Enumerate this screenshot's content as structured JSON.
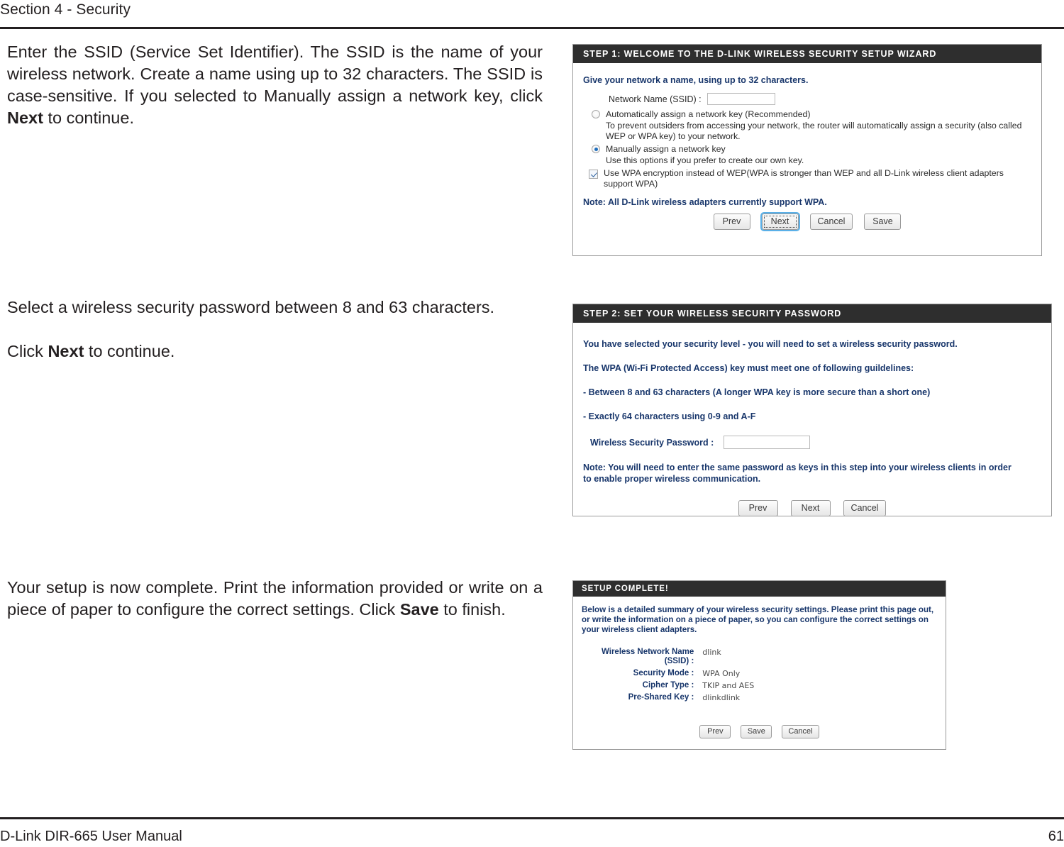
{
  "header": {
    "section_title": "Section 4 - Security"
  },
  "footer": {
    "manual_name": "D-Link DIR-665 User Manual",
    "page_number": "61"
  },
  "body_copy": [
    {
      "id": "copy-step1",
      "parts": [
        {
          "text": "Enter the SSID (Service Set Identifier). The SSID is the name of your wireless network. Create a name using up to 32 characters. The SSID is case-sensitive. If you selected to Manually assign a network key, click ",
          "bold": false
        },
        {
          "text": "Next",
          "bold": true
        },
        {
          "text": " to continue.",
          "bold": false
        }
      ]
    },
    {
      "id": "copy-step2",
      "line1": "Select a wireless security password between 8 and 63 characters.",
      "parts": [
        {
          "text": "Click ",
          "bold": false
        },
        {
          "text": "Next",
          "bold": true
        },
        {
          "text": " to continue.",
          "bold": false
        }
      ]
    },
    {
      "id": "copy-complete",
      "parts": [
        {
          "text": "Your setup is now complete. Print the information provided or write on a piece of paper to configure the correct settings. Click ",
          "bold": false
        },
        {
          "text": "Save",
          "bold": true
        },
        {
          "text": " to finish.",
          "bold": false
        }
      ]
    }
  ],
  "step1": {
    "title": "STEP 1: WELCOME TO THE D-LINK WIRELESS SECURITY SETUP WIZARD",
    "lead": "Give your network a name, using up to 32 characters.",
    "ssid_label": "Network Name (SSID) :",
    "ssid_value": "",
    "ssid_placeholder": "",
    "option_auto": {
      "label": "Automatically assign a network key (Recommended)",
      "description": "To prevent outsiders from accessing your network, the router will automatically assign a security (also called WEP or WPA key) to your network.",
      "selected": false
    },
    "option_manual": {
      "label": "Manually assign a network key",
      "description": "Use this options if you prefer to create our own key.",
      "selected": true
    },
    "wpa_checkbox": {
      "label": "Use WPA encryption instead of WEP(WPA is stronger than WEP and all D-Link wireless client adapters support WPA)",
      "checked": true
    },
    "note": "Note: All D-Link wireless adapters currently support WPA.",
    "buttons": [
      {
        "label": "Prev",
        "focused": false
      },
      {
        "label": "Next",
        "focused": true
      },
      {
        "label": "Cancel",
        "focused": false
      },
      {
        "label": "Save",
        "focused": false
      }
    ]
  },
  "step2": {
    "title": "STEP 2: SET YOUR WIRELESS SECURITY PASSWORD",
    "line1": "You have selected your security level - you will need to set a wireless security password.",
    "line2": "The WPA (Wi-Fi Protected Access) key must meet one of following guildelines:",
    "line3": "- Between 8 and 63 characters (A longer WPA key is more secure than a short one)",
    "line4": "- Exactly 64 characters using 0-9 and A-F",
    "password_label": "Wireless Security Password :",
    "password_value": "",
    "password_placeholder": "",
    "note": "Note: You will need to enter the same password as keys in this step into your wireless clients in order to enable proper wireless communication.",
    "buttons": [
      {
        "label": "Prev",
        "focused": false
      },
      {
        "label": "Next",
        "focused": false
      },
      {
        "label": "Cancel",
        "focused": false
      }
    ]
  },
  "complete": {
    "title": "SETUP COMPLETE!",
    "intro": "Below is a detailed summary of your wireless security settings. Please print this page out, or write the information on a piece of paper, so you can configure the correct settings on your wireless client adapters.",
    "summary": [
      {
        "key": "Wireless Network Name\n(SSID) :",
        "value": "dlink"
      },
      {
        "key": "Security Mode :",
        "value": "WPA Only"
      },
      {
        "key": "Cipher Type :",
        "value": "TKIP and AES"
      },
      {
        "key": "Pre-Shared Key :",
        "value": "dlinkdlink"
      }
    ],
    "buttons": [
      {
        "label": "Prev",
        "focused": false
      },
      {
        "label": "Save",
        "focused": false
      },
      {
        "label": "Cancel",
        "focused": false
      }
    ]
  },
  "colors": {
    "panel_header_bg": "#2e2e2e",
    "blue_text": "#18366b",
    "focus_outline": "#5ab0e8",
    "radio_dot": "#1f6ebd"
  }
}
